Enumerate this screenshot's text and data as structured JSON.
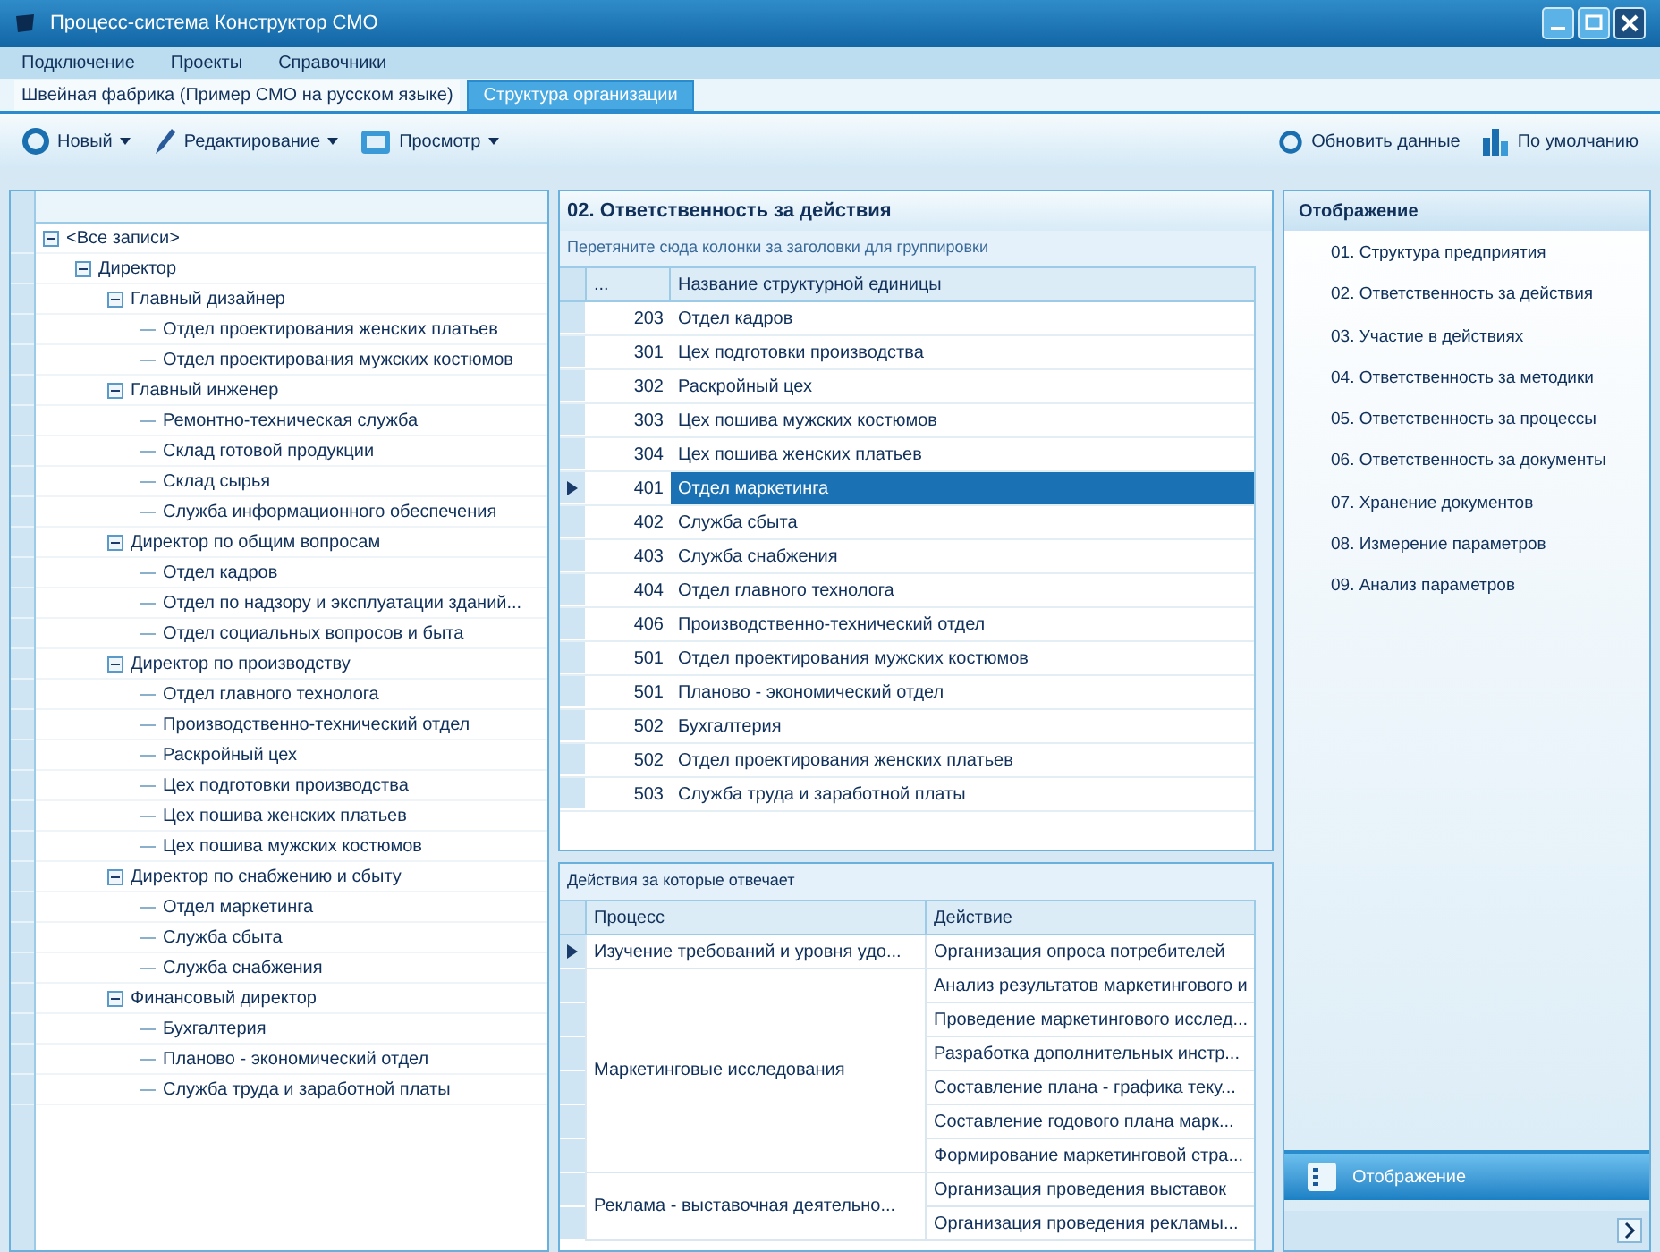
{
  "window": {
    "title": "Процесс-система Конструктор СМО"
  },
  "menu": [
    "Подключение",
    "Проекты",
    "Справочники"
  ],
  "tabs": [
    {
      "label": "Швейная фабрика (Пример СМО на русском языке)",
      "selected": false
    },
    {
      "label": "Структура организации",
      "selected": true
    }
  ],
  "toolbar": {
    "left": [
      {
        "label": "Новый",
        "kind": "new"
      },
      {
        "label": "Редактирование",
        "kind": "edit"
      },
      {
        "label": "Просмотр",
        "kind": "view"
      }
    ],
    "right": [
      {
        "label": "Обновить данные",
        "kind": "refresh"
      },
      {
        "label": "По умолчанию",
        "kind": "default"
      }
    ]
  },
  "tree": [
    {
      "label": "<Все записи>",
      "expanded": true,
      "children": [
        {
          "label": "Директор",
          "expanded": true,
          "children": [
            {
              "label": "Главный дизайнер",
              "expanded": true,
              "children": [
                {
                  "label": "Отдел проектирования женских платьев"
                },
                {
                  "label": "Отдел проектирования мужских костюмов"
                }
              ]
            },
            {
              "label": "Главный инженер",
              "expanded": true,
              "children": [
                {
                  "label": "Ремонтно-техническая служба"
                },
                {
                  "label": "Склад готовой продукции"
                },
                {
                  "label": "Склад сырья"
                },
                {
                  "label": "Служба информационного обеспечения"
                }
              ]
            },
            {
              "label": "Директор по общим вопросам",
              "expanded": true,
              "children": [
                {
                  "label": "Отдел кадров"
                },
                {
                  "label": "Отдел по надзору и эксплуатации зданий..."
                },
                {
                  "label": "Отдел социальных вопросов и быта"
                }
              ]
            },
            {
              "label": "Директор по производству",
              "expanded": true,
              "children": [
                {
                  "label": "Отдел главного технолога"
                },
                {
                  "label": "Производственно-технический отдел"
                },
                {
                  "label": "Раскройный цех"
                },
                {
                  "label": "Цех подготовки производства"
                },
                {
                  "label": "Цех пошива женских платьев"
                },
                {
                  "label": "Цех пошива мужских костюмов"
                }
              ]
            },
            {
              "label": "Директор по снабжению и сбыту",
              "expanded": true,
              "children": [
                {
                  "label": "Отдел маркетинга"
                },
                {
                  "label": "Служба сбыта"
                },
                {
                  "label": "Служба снабжения"
                }
              ]
            },
            {
              "label": "Финансовый директор",
              "expanded": true,
              "children": [
                {
                  "label": "Бухгалтерия"
                },
                {
                  "label": "Планово - экономический отдел"
                },
                {
                  "label": "Служба труда и заработной платы"
                }
              ]
            }
          ]
        }
      ]
    }
  ],
  "units": {
    "title": "02. Ответственность за действия",
    "group_hint": "Перетяните сюда колонки за заголовки для группировки",
    "columns": [
      "...",
      "Название структурной единицы"
    ],
    "rows": [
      {
        "code": "203",
        "name": "Отдел кадров",
        "selected": false
      },
      {
        "code": "301",
        "name": "Цех подготовки производства",
        "selected": false
      },
      {
        "code": "302",
        "name": "Раскройный цех",
        "selected": false
      },
      {
        "code": "303",
        "name": "Цех пошива мужских костюмов",
        "selected": false
      },
      {
        "code": "304",
        "name": "Цех пошива женских платьев",
        "selected": false
      },
      {
        "code": "401",
        "name": "Отдел маркетинга",
        "selected": true
      },
      {
        "code": "402",
        "name": "Служба сбыта",
        "selected": false
      },
      {
        "code": "403",
        "name": "Служба снабжения",
        "selected": false
      },
      {
        "code": "404",
        "name": "Отдел главного технолога",
        "selected": false
      },
      {
        "code": "406",
        "name": "Производственно-технический отдел",
        "selected": false
      },
      {
        "code": "501",
        "name": "Отдел проектирования мужских костюмов",
        "selected": false
      },
      {
        "code": "501",
        "name": "Планово - экономический отдел",
        "selected": false
      },
      {
        "code": "502",
        "name": "Бухгалтерия",
        "selected": false
      },
      {
        "code": "502",
        "name": "Отдел проектирования женских платьев",
        "selected": false
      },
      {
        "code": "503",
        "name": "Служба труда и заработной платы",
        "selected": false
      }
    ]
  },
  "actions": {
    "title": "Действия за которые отвечает",
    "columns": [
      "Процесс",
      "Действие"
    ],
    "groups": [
      {
        "process": "Изучение требований и уровня удо...",
        "selected": true,
        "actions": [
          "Организация опроса потребителей"
        ]
      },
      {
        "process": "Маркетинговые исследования",
        "selected": false,
        "actions": [
          "Анализ результатов маркетингового и",
          "Проведение маркетингового исслед...",
          "Разработка дополнительных инстр...",
          "Составление плана - графика теку...",
          "Составление годового плана марк...",
          "Формирование маркетинговой стра..."
        ]
      },
      {
        "process": "Реклама - выставочная деятельно...",
        "selected": false,
        "actions": [
          "Организация проведения выставок",
          "Организация проведения рекламы..."
        ]
      }
    ]
  },
  "views": {
    "title": "Отображение",
    "items": [
      "01. Структура предприятия",
      "02. Ответственность за действия",
      "03. Участие в действиях",
      "04. Ответственность за методики",
      "05. Ответственность за процессы",
      "06. Ответственность за документы",
      "07. Хранение документов",
      "08. Измерение параметров",
      "09. Анализ параметров"
    ],
    "bottom_button": "Отображение"
  }
}
